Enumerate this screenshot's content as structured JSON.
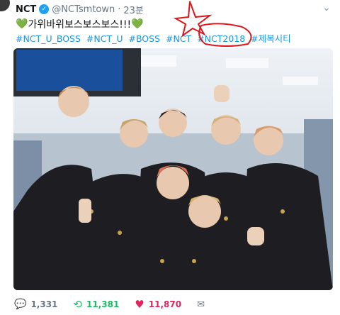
{
  "tweet": {
    "display_name": "NCT",
    "handle": "@NCTsmtown",
    "separator": "·",
    "time": "23분",
    "text": "가위바위보스보스보스!!!",
    "hashtags": [
      "#NCT_U_BOSS",
      "#NCT_U",
      "#BOSS",
      "#NCT",
      "#NCT2018",
      "#제복시티"
    ],
    "stats": {
      "replies": "1,331",
      "retweets": "11,381",
      "likes": "11,870"
    }
  },
  "icons": {
    "avatar": "avatar",
    "verified": "verified-icon",
    "menu": "chevron-down-icon",
    "reply": "reply-icon",
    "retweet": "retweet-icon",
    "like": "heart-icon",
    "message": "mail-icon",
    "emoji": "green-heart-icon"
  },
  "colors": {
    "link": "#1b95e0",
    "retweet": "#17bf63",
    "like": "#e0245e",
    "annotation": "#e0151b"
  }
}
